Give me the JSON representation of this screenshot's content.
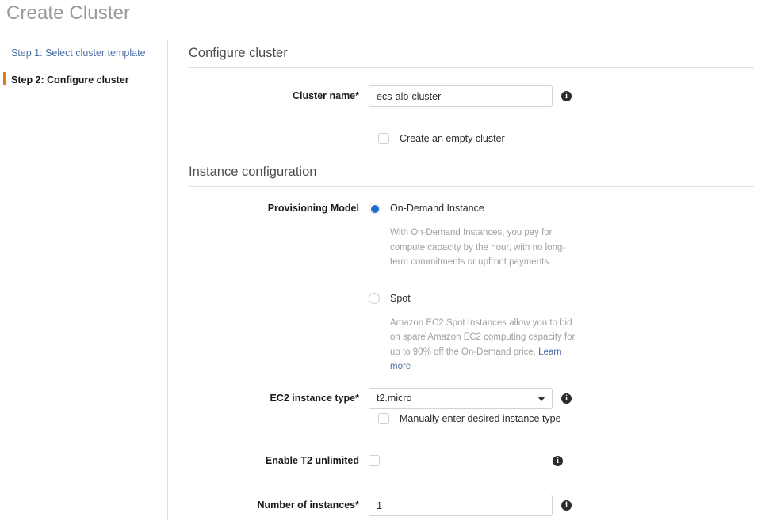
{
  "page": {
    "title": "Create Cluster"
  },
  "sidebar": {
    "steps": [
      {
        "label": "Step 1: Select cluster template",
        "state": "done"
      },
      {
        "label": "Step 2: Configure cluster",
        "state": "current"
      }
    ]
  },
  "main": {
    "sections": [
      {
        "heading": "Configure cluster"
      },
      {
        "heading": "Instance configuration"
      }
    ],
    "cluster_name": {
      "label": "Cluster name*",
      "value": "ecs-alb-cluster",
      "placeholder": "",
      "info": "i"
    },
    "empty_cluster": {
      "label": "Create an empty cluster",
      "checked": false
    },
    "provisioning_model": {
      "label": "Provisioning Model",
      "options": [
        {
          "label": "On-Demand Instance",
          "selected": true,
          "description": "With On-Demand Instances, you pay for compute capacity by the hour, with no long-term commitments or upfront payments.",
          "link_text": "",
          "link_tail": ""
        },
        {
          "label": "Spot",
          "selected": false,
          "description": "Amazon EC2 Spot Instances allow you to bid on spare Amazon EC2 computing capacity for up to 90% off the On-Demand price. ",
          "link_text": "Learn more",
          "link_tail": ""
        }
      ]
    },
    "ec2_instance_type": {
      "label": "EC2 instance type*",
      "value": "t2.micro",
      "info": "i"
    },
    "manual_instance_type": {
      "label": "Manually enter desired instance type",
      "checked": false
    },
    "t2_unlimited": {
      "label": "Enable T2 unlimited",
      "checked": false,
      "info": "i"
    },
    "number_of_instances": {
      "label": "Number of instances*",
      "value": "1",
      "placeholder": "",
      "info": "i"
    }
  },
  "colors": {
    "accent_orange": "#e07b18",
    "link_blue": "#4a6fa5",
    "radio_blue": "#1f6bd0",
    "title_gray": "#9a9a9a"
  }
}
